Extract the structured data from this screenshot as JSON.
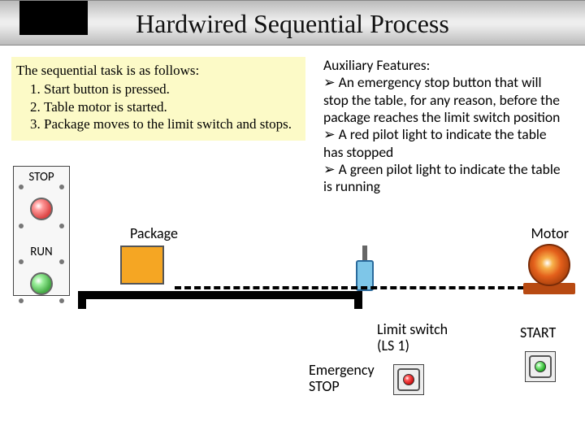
{
  "title": "Hardwired Sequential Process",
  "task": {
    "lead": "The sequential task is as follows:",
    "steps": [
      "Start button is pressed.",
      "Table motor is started.",
      "Package moves to the limit switch and stops."
    ]
  },
  "aux": {
    "title": "Auxiliary Features:",
    "items": [
      "An emergency stop button that will stop the table, for any reason, before the package reaches the limit switch position",
      "A red pilot light to indicate the table has stopped",
      "A green pilot light to indicate the table is running"
    ]
  },
  "indicator": {
    "stop": "STOP",
    "run": "RUN"
  },
  "labels": {
    "package": "Package",
    "motor": "Motor",
    "limit_switch_line1": "Limit switch",
    "limit_switch_line2": "(LS 1)",
    "start": "START",
    "estop_line1": "Emergency",
    "estop_line2": "STOP"
  },
  "colors": {
    "stop_light": "#d44",
    "run_light": "#4a4",
    "package": "#f5a623",
    "limit_switch": "#7ec6e8",
    "motor": "#e35f1b"
  }
}
